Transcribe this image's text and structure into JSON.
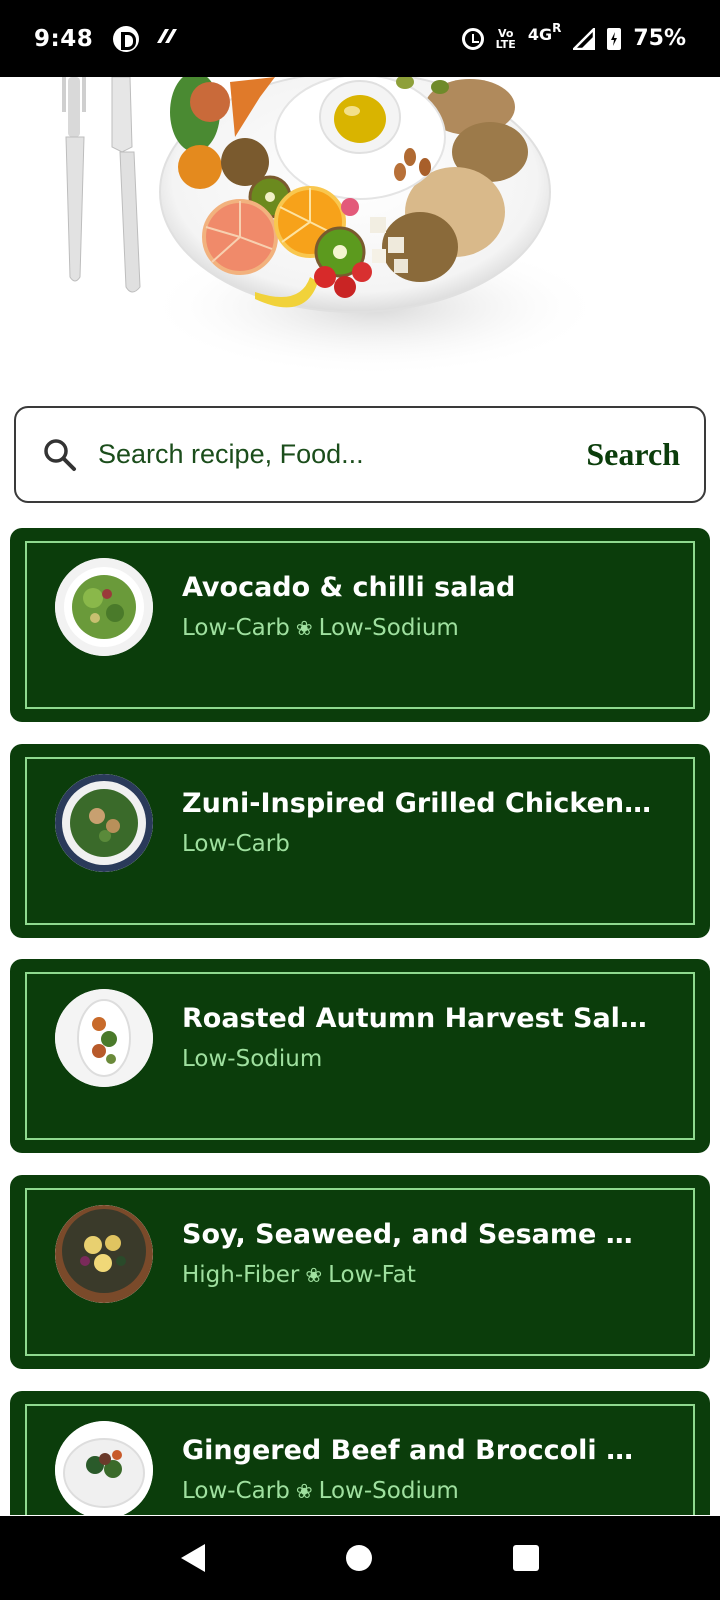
{
  "status_bar": {
    "time": "9:48",
    "volte_top": "Vo",
    "volte_bottom": "LTE",
    "network": "4G",
    "roaming": "R",
    "battery": "75%"
  },
  "hero": {
    "icon": "food-plate-illustration"
  },
  "search": {
    "placeholder": "Search recipe, Food...",
    "button_label": "Search"
  },
  "recipes": [
    {
      "title": "Avocado & chilli salad",
      "tags": [
        "Low-Carb",
        "Low-Sodium"
      ],
      "thumb": "green-salad-thumb"
    },
    {
      "title": "Zuni-Inspired Grilled Chicken S…",
      "tags": [
        "Low-Carb"
      ],
      "thumb": "chicken-salad-thumb"
    },
    {
      "title": "Roasted Autumn Harvest Salad",
      "tags": [
        "Low-Sodium"
      ],
      "thumb": "harvest-salad-thumb"
    },
    {
      "title": "Soy, Seaweed, and Sesame Pot…",
      "tags": [
        "High-Fiber",
        "Low-Fat"
      ],
      "thumb": "potato-salad-thumb"
    },
    {
      "title": "Gingered Beef and Broccoli Sal…",
      "tags": [
        "Low-Carb",
        "Low-Sodium"
      ],
      "thumb": "beef-broccoli-thumb"
    }
  ],
  "colors": {
    "card_bg": "#0b3d0b",
    "card_border": "#8fd98f",
    "tag_text": "#9fe09f",
    "accent": "#1b4d1b"
  }
}
